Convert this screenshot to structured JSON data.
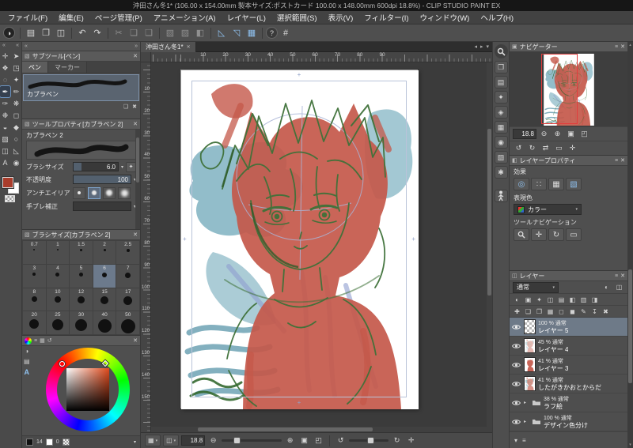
{
  "titlebar": {
    "title": "沖田さん冬1* (106.00 x 154.00mm 製本サイズ:ポストカード 100.00 x 148.00mm 600dpi 18.8%) - CLIP STUDIO PAINT EX"
  },
  "menubar": {
    "items": [
      "ファイル(F)",
      "編集(E)",
      "ページ管理(P)",
      "アニメーション(A)",
      "レイヤー(L)",
      "選択範囲(S)",
      "表示(V)",
      "フィルター(I)",
      "ウィンドウ(W)",
      "ヘルプ(H)"
    ]
  },
  "toolbar": {
    "icons": [
      {
        "name": "clip-studio-logo",
        "glyph": "◑"
      },
      {
        "name": "new-file",
        "glyph": "▤"
      },
      {
        "name": "open-file",
        "glyph": "❐"
      },
      {
        "name": "save-file",
        "glyph": "◫"
      },
      {
        "name": "undo",
        "glyph": "↶"
      },
      {
        "name": "redo",
        "glyph": "↷"
      },
      {
        "name": "cut",
        "glyph": "✂"
      },
      {
        "name": "copy",
        "glyph": "❏"
      },
      {
        "name": "paste",
        "glyph": "❑"
      },
      {
        "name": "deselect",
        "glyph": "▧"
      },
      {
        "name": "invert-selection",
        "glyph": "▨"
      },
      {
        "name": "selection-border",
        "glyph": "◧"
      },
      {
        "name": "snap-to-ruler",
        "glyph": "◺"
      },
      {
        "name": "snap-to-special-ruler",
        "glyph": "◹"
      },
      {
        "name": "snap-to-grid",
        "glyph": "▦"
      },
      {
        "name": "help",
        "glyph": "?"
      },
      {
        "name": "grid",
        "glyph": "#"
      }
    ]
  },
  "tools": {
    "glyphs": [
      "✛",
      "➤",
      "❖",
      "◳",
      "◌",
      "✦",
      "✒",
      "✏",
      "✑",
      "❋",
      "❉",
      "◻",
      "◒",
      "◆",
      "▨",
      "○",
      "◫",
      "◺",
      "A",
      "◉"
    ]
  },
  "subtool": {
    "title": "サブツール[ペン]",
    "tabs": [
      "ペン",
      "マーカー"
    ],
    "item": "カブラペン"
  },
  "tool_property": {
    "title": "ツールプロパティ[カブラペン 2]",
    "tool_name": "カブラペン 2",
    "rows": [
      {
        "label": "ブラシサイズ",
        "value": "6.0"
      },
      {
        "label": "不透明度",
        "value": "100"
      }
    ],
    "anti_label": "アンチエイリアス",
    "stabilize_label": "手ブレ補正"
  },
  "brush_size": {
    "title": "ブラシサイズ[カブラペン 2]",
    "sizes": [
      "0.7",
      "1",
      "1.5",
      "2",
      "2.5",
      "3",
      "4",
      "5",
      "6",
      "7",
      "8",
      "10",
      "12",
      "15",
      "17",
      "20",
      "25",
      "30",
      "40",
      "50"
    ],
    "selected": "6"
  },
  "color_panel": {
    "values": [
      "14",
      "0"
    ],
    "hue_hex": "#e04a1c",
    "fg_color": "#a93c2b"
  },
  "document": {
    "tab": "沖田さん冬1*",
    "zoom": "18.8"
  },
  "rulers": {
    "h": [
      "10",
      "20",
      "30",
      "40",
      "50",
      "60",
      "70",
      "80",
      "90"
    ],
    "v": [
      "10",
      "20",
      "30",
      "40",
      "50",
      "60",
      "70",
      "80",
      "90",
      "100",
      "110",
      "120",
      "130",
      "140",
      "150"
    ]
  },
  "navigator": {
    "title": "ナビゲーター",
    "zoom": "18.8",
    "row1": [
      {
        "name": "zoom-out",
        "glyph": "⊖"
      },
      {
        "name": "zoom-in",
        "glyph": "⊕"
      },
      {
        "name": "fit-to-screen",
        "glyph": "▣"
      },
      {
        "name": "actual-size",
        "glyph": "◰"
      }
    ],
    "row2": [
      {
        "name": "rotate-left",
        "glyph": "↺"
      },
      {
        "name": "rotate-right",
        "glyph": "↻"
      },
      {
        "name": "flip-horizontal",
        "glyph": "⇄"
      },
      {
        "name": "reset-display",
        "glyph": "▭"
      },
      {
        "name": "reset-rotation",
        "glyph": "✛"
      }
    ]
  },
  "layer_property": {
    "title": "レイヤープロパティ",
    "effect_label": "効果",
    "effects": [
      {
        "name": "border-effect",
        "glyph": "◎"
      },
      {
        "name": "tone-effect",
        "glyph": "∷"
      },
      {
        "name": "layer-color-effect",
        "glyph": "▦"
      },
      {
        "name": "extract-line-effect",
        "glyph": "▧"
      }
    ],
    "expression_label": "表現色",
    "expression_value": "カラー",
    "tool_nav_label": "ツールナビゲーション",
    "tool_nav": [
      {
        "name": "nav-move",
        "glyph": "✛"
      },
      {
        "name": "nav-rotate",
        "glyph": "↻"
      },
      {
        "name": "nav-fit",
        "glyph": "▭"
      }
    ]
  },
  "layers": {
    "title": "レイヤー",
    "blend_mode": "通常",
    "fence_icons": [
      "◐",
      "▣",
      "✦",
      "◫",
      "▤",
      "◧",
      "▥",
      "◨"
    ],
    "cmd_icons": [
      "✚",
      "❏",
      "❐",
      "▦",
      "◻",
      "◼",
      "✎",
      "↧",
      "✖"
    ],
    "items": [
      {
        "meta": "100 % 通常",
        "name": "レイヤー 5",
        "selected": true
      },
      {
        "meta": "45 % 通常",
        "name": "レイヤー 4",
        "selected": false
      },
      {
        "meta": "41 % 通常",
        "name": "レイヤー 3",
        "selected": false
      },
      {
        "meta": "41 % 通常",
        "name": "したがきかおとからだ",
        "selected": false
      },
      {
        "meta": "38 % 通常",
        "name": "ラフ絵",
        "selected": false
      },
      {
        "meta": "100 % 通常",
        "name": "デザイン色分け",
        "selected": false
      }
    ]
  },
  "canvas_footer": {
    "left_buttons": [
      {
        "name": "page-layout",
        "glyph": "▦"
      },
      {
        "name": "spread-view",
        "glyph": "◫"
      }
    ],
    "zoom_value": "18.8",
    "zoom_buttons": [
      {
        "name": "zoom-out",
        "glyph": "⊖"
      },
      {
        "name": "zoom-in",
        "glyph": "⊕"
      },
      {
        "name": "fit-to-screen",
        "glyph": "▣"
      },
      {
        "name": "actual-size",
        "glyph": "◰"
      }
    ],
    "rotate_buttons": [
      {
        "name": "rotate-left",
        "glyph": "↺"
      },
      {
        "name": "rotate-right",
        "glyph": "↻"
      },
      {
        "name": "reset-rotation",
        "glyph": "✛"
      }
    ]
  },
  "rightstrip": {
    "icons": [
      "❐",
      "▤",
      "✦",
      "◈",
      "▦",
      "◉",
      "▧",
      "✱"
    ]
  },
  "colors": {
    "accent_blue": "#8fc1ef",
    "selected_row": "#6e7a88",
    "sketch_red": "#c4584a",
    "sketch_green": "#3f7139",
    "sketch_teal": "#579aae",
    "view_rect_red": "#e03c3c"
  }
}
